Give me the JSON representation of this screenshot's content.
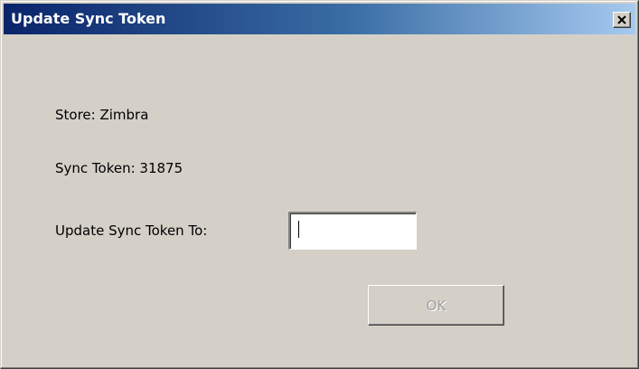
{
  "window": {
    "title": "Update Sync Token",
    "close_glyph": "close-icon"
  },
  "form": {
    "store_text": "Store: Zimbra",
    "sync_token_text": "Sync Token: 31875",
    "update_label": "Update Sync Token To:",
    "update_value": "",
    "ok_label": "OK",
    "ok_enabled": false
  },
  "colors": {
    "titlebar_start": "#0a246a",
    "titlebar_end": "#a6caf0",
    "dialog_bg": "#d4d0c8",
    "disabled_text": "#a0a0a0"
  }
}
